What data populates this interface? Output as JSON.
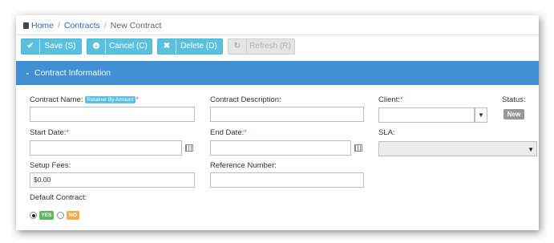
{
  "breadcrumb": {
    "home": "Home",
    "contracts": "Contracts",
    "current": "New Contract",
    "separator": "/"
  },
  "toolbar": {
    "save": {
      "label": "Save (S)",
      "icon": "✔"
    },
    "cancel": {
      "label": "Cancel (C)"
    },
    "delete": {
      "label": "Delete (D)",
      "icon": "✖"
    },
    "refresh": {
      "label": "Refresh (R)",
      "icon": "↻"
    }
  },
  "panel": {
    "title": "Contract Information",
    "chevron": "⌄"
  },
  "form": {
    "contract_name_label": "Contract Name:",
    "retainer_tag": "Retainer By Amount",
    "required_mark": "*",
    "contract_description_label": "Contract Description:",
    "client_label": "Client:",
    "status_label": "Status:",
    "status_value": "New",
    "start_date_label": "Start Date:",
    "end_date_label": "End Date:",
    "sla_label": "SLA:",
    "setup_fees_label": "Setup Fees:",
    "setup_fees_value": "$0.00",
    "reference_number_label": "Reference Number:",
    "default_contract_label": "Default Contract:",
    "yes_label": "YES",
    "no_label": "NO",
    "dropdown_arrow": "▼"
  },
  "colors": {
    "primary_button": "#5bc0de",
    "panel_header": "#3f8fd2",
    "yes": "#5cb85c",
    "no": "#f0ad4e"
  }
}
